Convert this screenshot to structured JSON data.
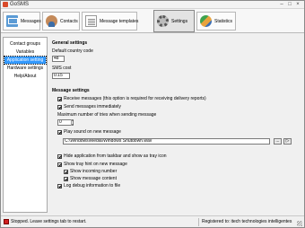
{
  "window": {
    "title": "GoSMS"
  },
  "toolbar": {
    "messages": "Messages",
    "contacts": "Contacts",
    "templates": "Message templates",
    "settings": "Settings",
    "statistics": "Statistics"
  },
  "sidebar": {
    "items": [
      {
        "label": "Contact groups"
      },
      {
        "label": "Variables"
      },
      {
        "label": "Application setting"
      },
      {
        "label": "Hardware settings"
      },
      {
        "label": "Help/About"
      }
    ],
    "active_index": 2
  },
  "general": {
    "title": "General settings",
    "country_code_label": "Default country code",
    "country_code_value": "48",
    "sms_cost_label": "SMS cost",
    "sms_cost_value": "0.15"
  },
  "message": {
    "title": "Message settings",
    "receive_label": "Receive messages (this option is required for receiving delivery reports)",
    "receive_checked": true,
    "send_immediately_label": "Send messages immediately",
    "send_immediately_checked": true,
    "max_tries_label": "Maximum number of tries when sending message",
    "max_tries_value": "0",
    "play_sound_label": "Play sound on new message",
    "play_sound_checked": true,
    "sound_path": "C:\\Windows\\Media\\Windows Shutdown.wav",
    "browse_label": "...",
    "play_button_label": "▷",
    "hide_taskbar_label": "Hide application from taskbar  and show as tray icon",
    "hide_taskbar_checked": true,
    "tray_hint_label": "Show tray hint on new message",
    "tray_hint_checked": true,
    "incoming_number_label": "Show incoming number",
    "incoming_number_checked": true,
    "message_content_label": "Show message content",
    "message_content_checked": true,
    "log_debug_label": "Log debug information to file",
    "log_debug_checked": true
  },
  "status": {
    "text": "Stopped. Leave settings tab to restart.",
    "registered": "Registered to: itech technologies intelligentes",
    "indicator_color": "#d02020"
  },
  "colors": {
    "selection": "#3399ff",
    "background": "#f0f0f0"
  },
  "icons": {
    "messages": "messages-icon",
    "contacts": "contacts-icon",
    "templates": "templates-icon",
    "settings": "gear-icon",
    "statistics": "pie-chart-icon"
  }
}
